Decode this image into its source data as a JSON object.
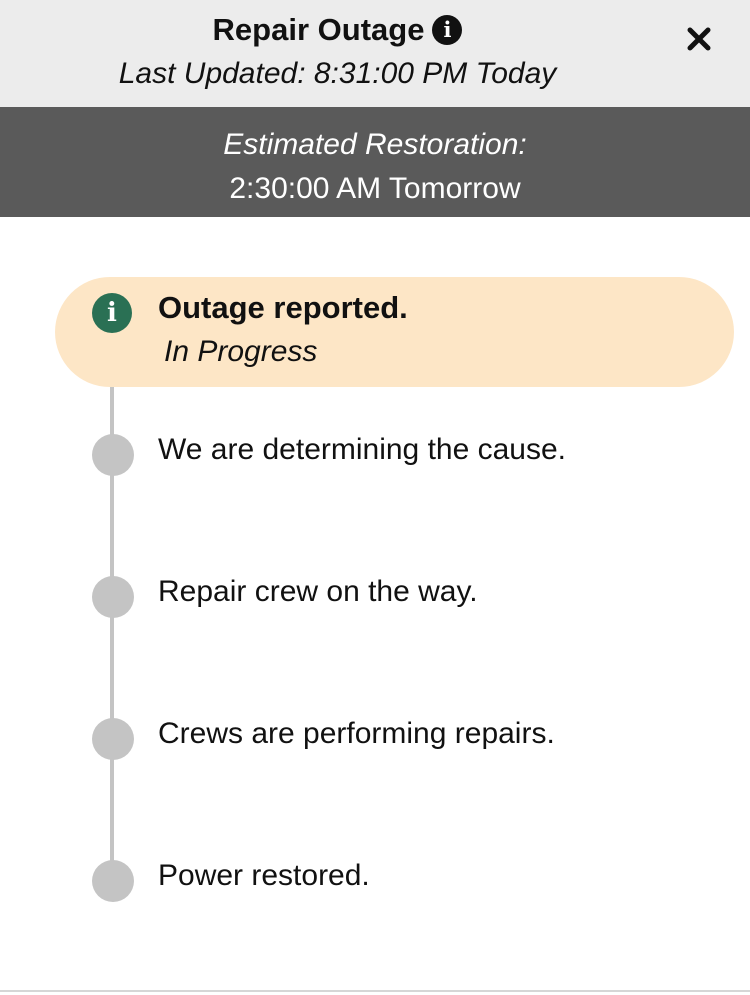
{
  "header": {
    "title": "Repair Outage",
    "title_info_icon": "info-icon",
    "last_updated": "Last Updated: 8:31:00 PM Today",
    "close_icon": "close-icon"
  },
  "restoration": {
    "label": "Estimated Restoration:",
    "time": "2:30:00 AM Tomorrow"
  },
  "timeline": {
    "active_step": {
      "icon": "info-icon",
      "title": "Outage reported.",
      "status": "In Progress"
    },
    "steps": [
      {
        "label": "We are determining the cause."
      },
      {
        "label": "Repair crew on the way."
      },
      {
        "label": "Crews are performing repairs."
      },
      {
        "label": "Power restored."
      }
    ]
  },
  "colors": {
    "header_bg": "#ececec",
    "restoration_bg": "#5a5a5a",
    "active_step_bg": "#fde6c6",
    "active_icon": "#2a7054",
    "pending_dot": "#c4c4c4"
  }
}
